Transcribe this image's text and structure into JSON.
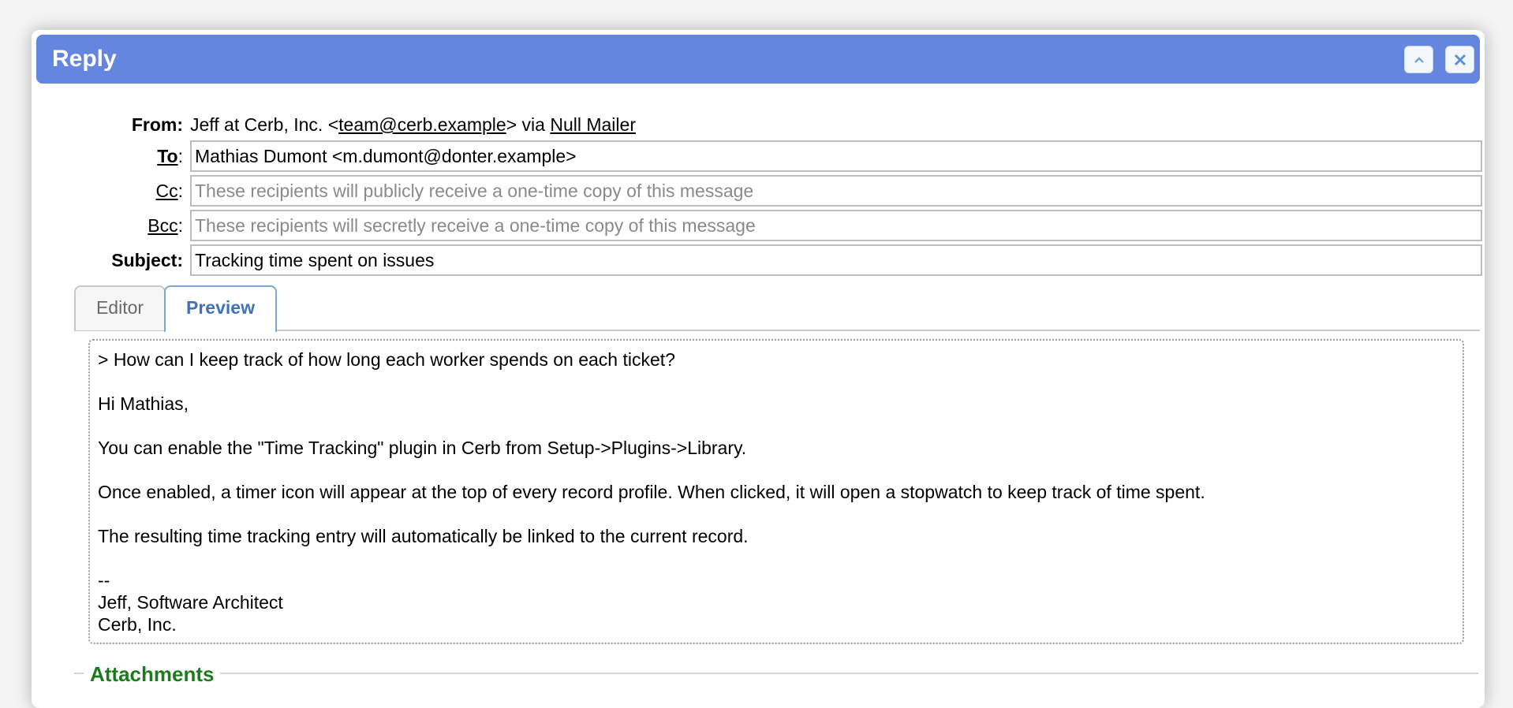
{
  "dialog": {
    "title": "Reply",
    "collapse_icon": "chevron-up-icon",
    "close_icon": "close-icon",
    "accent_color": "#6586de"
  },
  "from": {
    "label": "From:",
    "prefix": "Jeff at Cerb, Inc. <",
    "email": "team@cerb.example",
    "middle": "> via ",
    "transport": "Null Mailer"
  },
  "to": {
    "label": "To",
    "colon": ":",
    "value": "Mathias Dumont <m.dumont@donter.example>"
  },
  "cc": {
    "label": "Cc",
    "colon": ":",
    "placeholder": "These recipients will publicly receive a one-time copy of this message"
  },
  "bcc": {
    "label": "Bcc",
    "colon": ":",
    "placeholder": "These recipients will secretly receive a one-time copy of this message"
  },
  "subject": {
    "label": "Subject:",
    "value": "Tracking time spent on issues"
  },
  "tabs": [
    {
      "label": "Editor",
      "active": false
    },
    {
      "label": "Preview",
      "active": true
    }
  ],
  "preview": {
    "lines": [
      "> How can I keep track of how long each worker spends on each ticket?",
      "Hi Mathias,",
      "You can enable the \"Time Tracking\" plugin in Cerb from Setup->Plugins->Library.",
      "Once enabled, a timer icon will appear at the top of every record profile. When clicked, it will open a stopwatch to keep track of time spent.",
      "The resulting time tracking entry will automatically be linked to the current record.",
      "--",
      "Jeff, Software Architect",
      "Cerb, Inc."
    ]
  },
  "attachments": {
    "legend": "Attachments"
  }
}
